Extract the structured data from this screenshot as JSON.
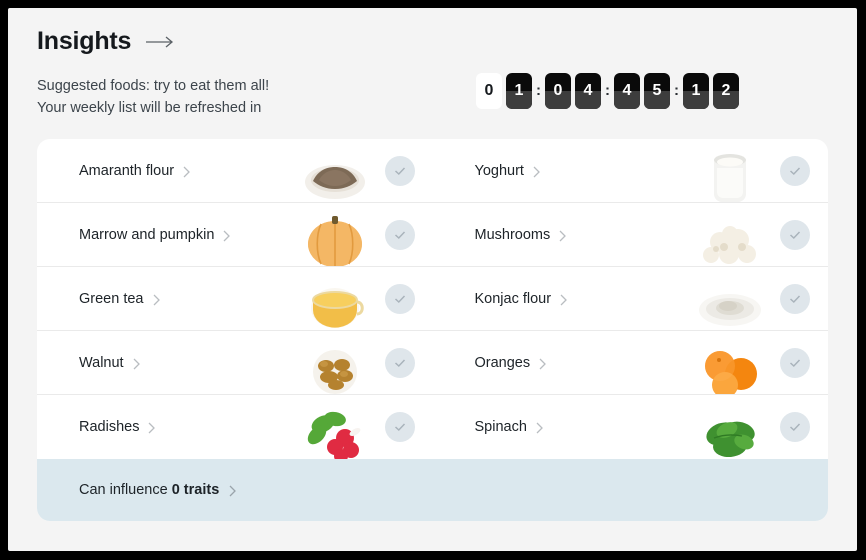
{
  "header": {
    "title": "Insights",
    "arrow_icon": "arrow-right-icon",
    "subtitle_line1": "Suggested foods: try to eat them all!",
    "subtitle_line2": "Your weekly list will be refreshed in"
  },
  "countdown": {
    "groups": [
      {
        "digits": [
          {
            "value": "0",
            "style": "light"
          },
          {
            "value": "1",
            "style": "dark"
          }
        ]
      },
      {
        "digits": [
          {
            "value": "0",
            "style": "dark"
          },
          {
            "value": "4",
            "style": "dark"
          }
        ]
      },
      {
        "digits": [
          {
            "value": "4",
            "style": "dark"
          },
          {
            "value": "5",
            "style": "dark"
          }
        ]
      },
      {
        "digits": [
          {
            "value": "1",
            "style": "dark"
          },
          {
            "value": "2",
            "style": "dark"
          }
        ]
      }
    ],
    "separator": ":"
  },
  "foods": [
    {
      "name": "Amaranth flour",
      "image": "amaranth-flour-photo",
      "checked_icon": "check-icon"
    },
    {
      "name": "Yoghurt",
      "image": "yoghurt-photo",
      "checked_icon": "check-icon"
    },
    {
      "name": "Marrow and pumpkin",
      "image": "pumpkin-photo",
      "checked_icon": "check-icon"
    },
    {
      "name": "Mushrooms",
      "image": "mushrooms-photo",
      "checked_icon": "check-icon"
    },
    {
      "name": "Green tea",
      "image": "green-tea-photo",
      "checked_icon": "check-icon"
    },
    {
      "name": "Konjac flour",
      "image": "konjac-flour-photo",
      "checked_icon": "check-icon"
    },
    {
      "name": "Walnut",
      "image": "walnut-photo",
      "checked_icon": "check-icon"
    },
    {
      "name": "Oranges",
      "image": "oranges-photo",
      "checked_icon": "check-icon"
    },
    {
      "name": "Radishes",
      "image": "radishes-photo",
      "checked_icon": "check-icon"
    },
    {
      "name": "Spinach",
      "image": "spinach-photo",
      "checked_icon": "check-icon"
    }
  ],
  "footer": {
    "prefix": "Can influence ",
    "emphasis": "0 traits",
    "chevron_icon": "chevron-right-icon"
  },
  "colors": {
    "page_background": "#f4f4f4",
    "card_background": "#ffffff",
    "footer_background": "#dbe8ee",
    "text_primary": "#1d2328",
    "badge_background": "#dfe6eb",
    "flip_dark": "#0a0a0a",
    "flip_dark_lower": "#3d3d3d"
  }
}
